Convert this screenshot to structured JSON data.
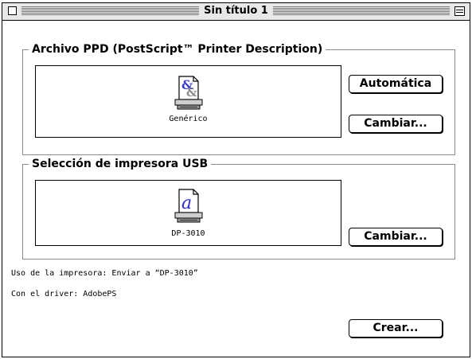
{
  "window": {
    "title": "Sin título 1"
  },
  "ppd_group": {
    "title": "Archivo PPD (PostScript™ Printer Description)",
    "icon_label": "Genérico",
    "auto_button": "Automática",
    "change_button": "Cambiar..."
  },
  "usb_group": {
    "title": "Selección de impresora USB",
    "icon_label": "DP-3010",
    "change_button": "Cambiar..."
  },
  "info": {
    "usage": "Uso de la impresora: Enviar a “DP-3010”",
    "driver": "Con el driver: AdobePS"
  },
  "create_button": "Crear...",
  "icons": {
    "ppd_icon": "generic-ppd-document-icon",
    "usb_icon": "printer-driver-document-icon",
    "close": "close-box-icon",
    "zoom": "zoom-box-icon"
  }
}
